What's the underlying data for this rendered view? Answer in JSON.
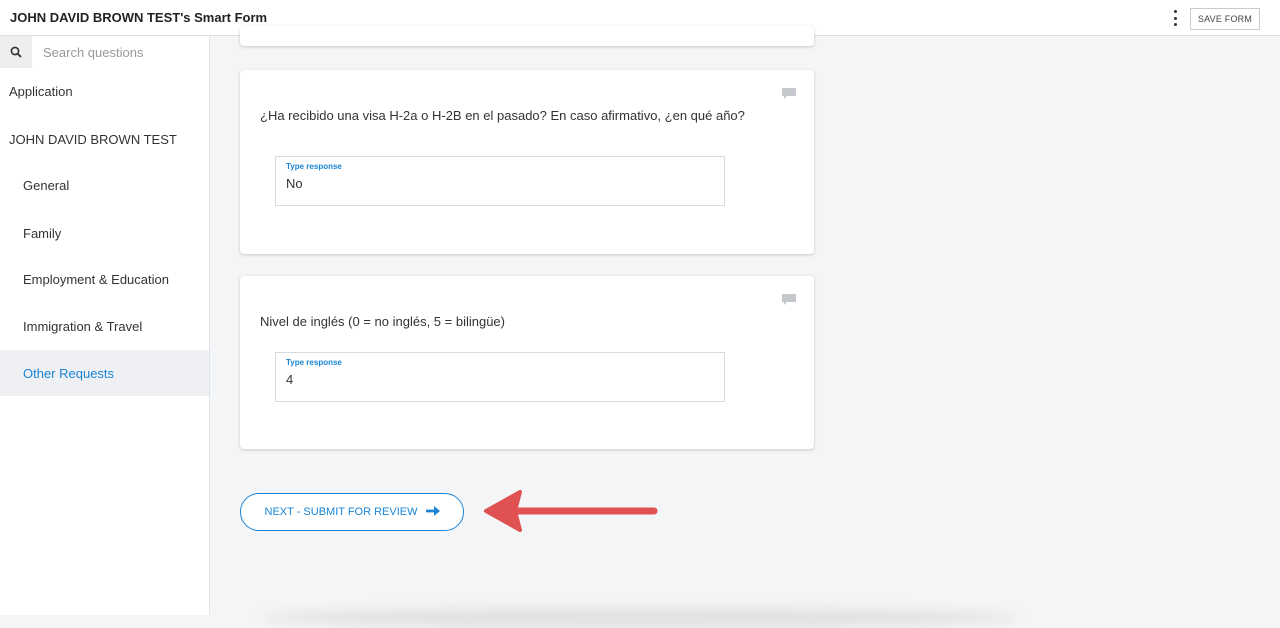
{
  "header": {
    "title": "JOHN DAVID BROWN TEST's Smart Form",
    "save_label": "SAVE FORM"
  },
  "sidebar": {
    "search_placeholder": "Search questions",
    "items": [
      {
        "label": "Application",
        "level": 0,
        "active": false
      },
      {
        "label": "JOHN DAVID BROWN TEST",
        "level": 0,
        "active": false
      },
      {
        "label": "General",
        "level": 1,
        "active": false
      },
      {
        "label": "Family",
        "level": 1,
        "active": false
      },
      {
        "label": "Employment & Education",
        "level": 1,
        "active": false
      },
      {
        "label": "Immigration & Travel",
        "level": 1,
        "active": false
      },
      {
        "label": "Other Requests",
        "level": 1,
        "active": true
      }
    ]
  },
  "questions": [
    {
      "text": "¿Ha recibido una visa H-2a o H-2B en el pasado? En caso afirmativo, ¿en qué año?",
      "response_label": "Type response",
      "response_value": "No"
    },
    {
      "text": "Nivel de inglés (0 = no inglés, 5 = bilingüe)",
      "response_label": "Type response",
      "response_value": "4"
    }
  ],
  "next_button": {
    "label": "NEXT - SUBMIT FOR REVIEW"
  },
  "colors": {
    "accent": "#1a85d6",
    "annotation_arrow": "#e05252"
  }
}
